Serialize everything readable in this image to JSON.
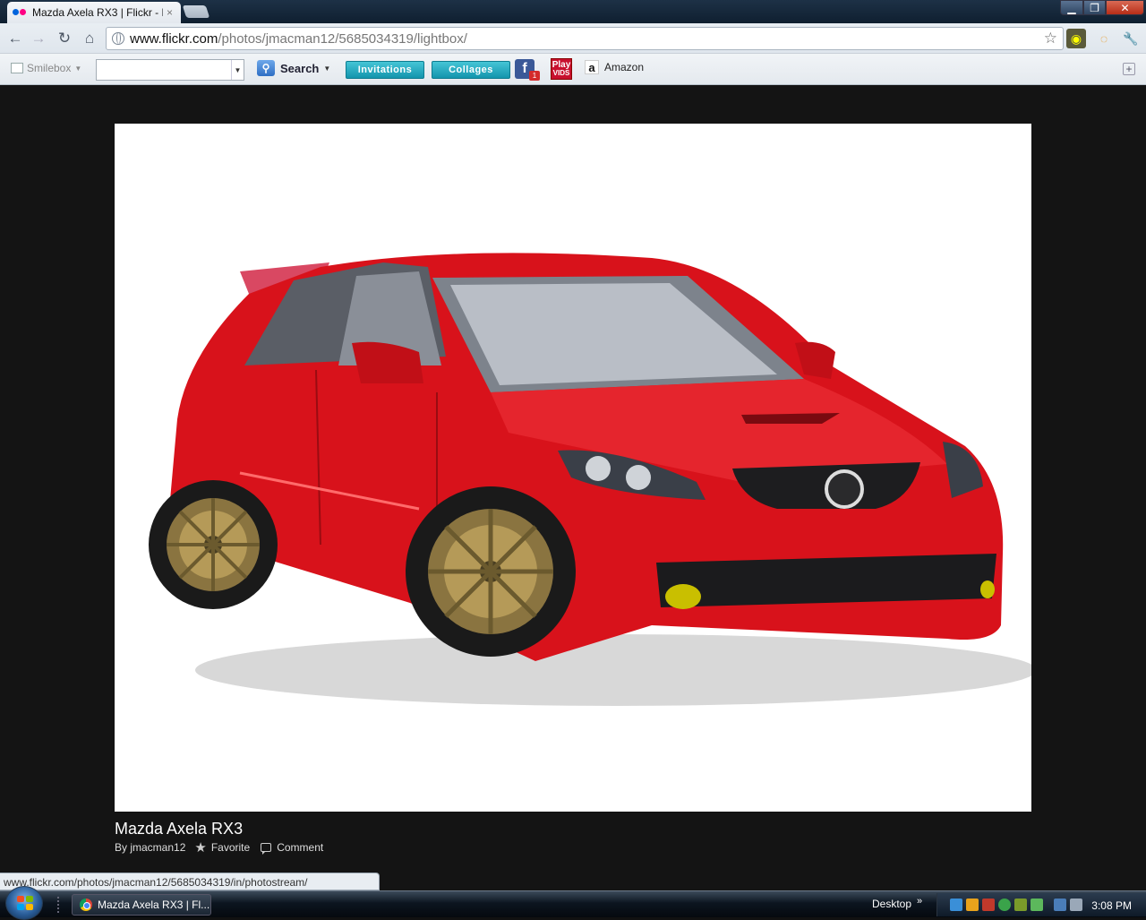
{
  "browser": {
    "tab": {
      "title": "Mazda Axela RX3 | Flickr - P",
      "close": "×"
    },
    "window_controls": {
      "minimize": "▁",
      "maximize": "❐",
      "close": "✕"
    },
    "nav": {
      "back": "←",
      "forward": "→",
      "reload": "↻",
      "home": "⌂"
    },
    "address": {
      "host": "www.flickr.com",
      "path": "/photos/jmacman12/5685034319/lightbox/"
    },
    "bookmark_star": "☆"
  },
  "toolbar": {
    "smilebox_label": "Smilebox",
    "search_label": "Search",
    "invitations_label": "Invitations",
    "collages_label": "Collages",
    "facebook_glyph": "f",
    "facebook_badge": "1",
    "play_top": "Play",
    "play_bottom": "VIDS",
    "amazon_glyph": "a",
    "amazon_label": "Amazon",
    "add_label": "+"
  },
  "photo": {
    "title": "Mazda Axela RX3",
    "by": "By jmacman12",
    "favorite_label": "Favorite",
    "comment_label": "Comment",
    "favorite_glyph": "★"
  },
  "status": {
    "hover_url": "www.flickr.com/photos/jmacman12/5685034319/in/photostream/"
  },
  "taskbar": {
    "window_button": "Mazda Axela RX3 | Fl...",
    "desktop_label": "Desktop",
    "desktop_chevron": "»",
    "time": "3:08 PM"
  }
}
